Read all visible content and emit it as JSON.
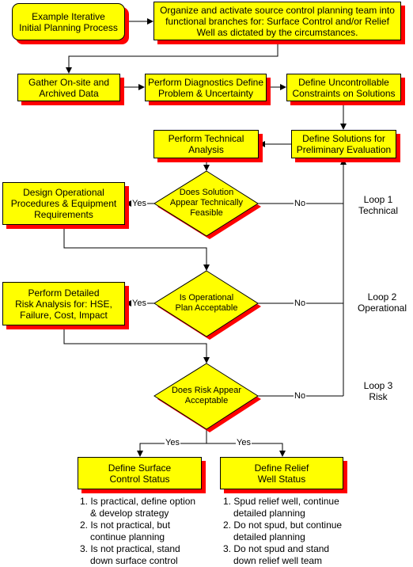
{
  "title_box": "Example Iterative\nInitial Planning Process",
  "boxes": {
    "organize": "Organize and activate source control planning team into\nfunctional branches for:  Surface Control and/or Relief\nWell as dictated by the circumstances.",
    "gather": "Gather On-site and\nArchived Data",
    "diagnostics": "Perform Diagnostics Define\nProblem & Uncertainty",
    "constraints": "Define Uncontrollable\nConstraints on Solutions",
    "solutions": "Define Solutions for\nPreliminary Evaluation",
    "technical": "Perform  Technical\nAnalysis",
    "design": "Design Operational\nProcedures & Equipment\nRequirements",
    "risk": "Perform Detailed\nRisk Analysis for: HSE,\nFailure, Cost, Impact",
    "surface": "Define Surface\nControl Status",
    "relief": "Define Relief\nWell Status"
  },
  "decisions": {
    "technical": "Does Solution\nAppear Technically\nFeasible",
    "operational": "Is Operational\nPlan Acceptable",
    "risk": "Does Risk Appear\nAcceptable"
  },
  "edge_labels": {
    "yes": "Yes",
    "no": "No"
  },
  "loops": [
    "Loop 1\nTechnical",
    "Loop 2\nOperational",
    "Loop 3\nRisk"
  ],
  "surface_outcomes": [
    "1. Is practical, define option & develop strategy",
    "2. Is not practical, but continue planning",
    "3. Is not practical, stand down surface control"
  ],
  "relief_outcomes": [
    "1. Spud relief well, continue detailed planning",
    "2. Do not spud, but continue detailed planning",
    "3. Do not spud and stand down relief well team"
  ],
  "colors": {
    "box_fill": "#ffff00",
    "shadow": "#ff0000",
    "line": "#000000"
  }
}
